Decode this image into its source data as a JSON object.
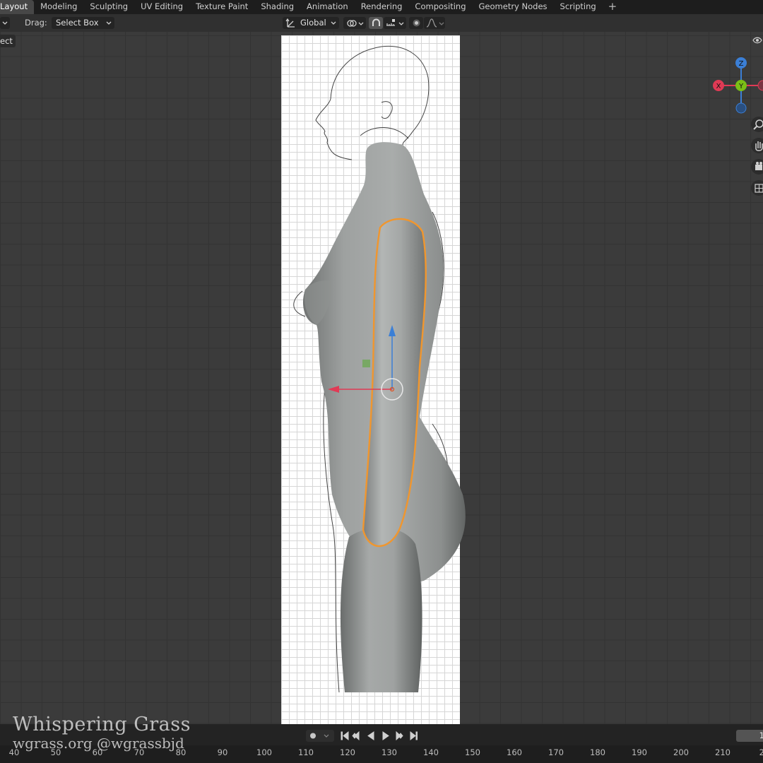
{
  "workspace_tabs": [
    {
      "label": "Layout",
      "active": true
    },
    {
      "label": "Modeling"
    },
    {
      "label": "Sculpting"
    },
    {
      "label": "UV Editing"
    },
    {
      "label": "Texture Paint"
    },
    {
      "label": "Shading"
    },
    {
      "label": "Animation"
    },
    {
      "label": "Rendering"
    },
    {
      "label": "Compositing"
    },
    {
      "label": "Geometry Nodes"
    },
    {
      "label": "Scripting"
    }
  ],
  "add_tab_label": "+",
  "header": {
    "drag_label": "Drag:",
    "drag_value": "Select Box",
    "orientation": "Global"
  },
  "viewport": {
    "select_button": "ect"
  },
  "gizmo": {
    "x": "X",
    "y": "Y",
    "z": "Z"
  },
  "timeline": {
    "current_frame": "1",
    "ruler_labels": [
      "40",
      "50",
      "60",
      "70",
      "80",
      "90",
      "100",
      "110",
      "120",
      "130",
      "140",
      "150",
      "160",
      "170",
      "180",
      "190",
      "200",
      "210",
      "22"
    ]
  },
  "watermark": {
    "line1": "Whispering Grass",
    "line2": "wgrass.org @wgrassbjd"
  },
  "colors": {
    "x_axis": "#e03a55",
    "y_axis": "#7bbf16",
    "z_axis": "#3b7fd6",
    "selection_outline": "#f0962e"
  }
}
